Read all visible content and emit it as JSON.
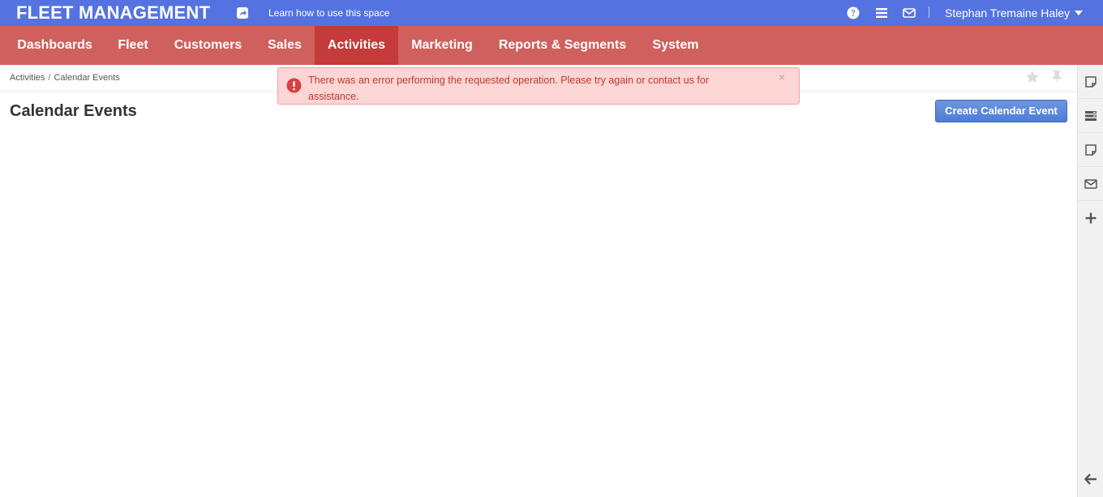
{
  "header": {
    "brand": "FLEET MANAGEMENT",
    "learn_link": "Learn how to use this space",
    "user_name": "Stephan Tremaine Haley"
  },
  "nav": {
    "items": [
      {
        "label": "Dashboards"
      },
      {
        "label": "Fleet"
      },
      {
        "label": "Customers"
      },
      {
        "label": "Sales"
      },
      {
        "label": "Activities",
        "active": true
      },
      {
        "label": "Marketing"
      },
      {
        "label": "Reports & Segments"
      },
      {
        "label": "System"
      }
    ]
  },
  "breadcrumb": {
    "parent": "Activities",
    "separator": "/",
    "current": "Calendar Events"
  },
  "page": {
    "title": "Calendar Events",
    "create_button": "Create Calendar Event"
  },
  "alert": {
    "message": "There was an error performing the requested operation. Please try again or contact us for assistance.",
    "close": "×"
  },
  "icons": {
    "share": "share-icon",
    "help": "help-icon",
    "menu": "menu-icon",
    "mail": "mail-icon",
    "caret": "caret-down-icon",
    "star": "star-icon",
    "pin": "pin-icon",
    "error": "error-icon",
    "rightbar": [
      "note-icon",
      "list-icon",
      "note-icon",
      "mail-icon",
      "plus-icon"
    ],
    "back": "arrow-left-icon"
  },
  "colors": {
    "topbar": "#5573e0",
    "nav": "#d0605e",
    "nav_active": "#c53a3a",
    "alert_bg": "#fcd5d5",
    "alert_text": "#c0392b",
    "button": "#5a86d8"
  }
}
